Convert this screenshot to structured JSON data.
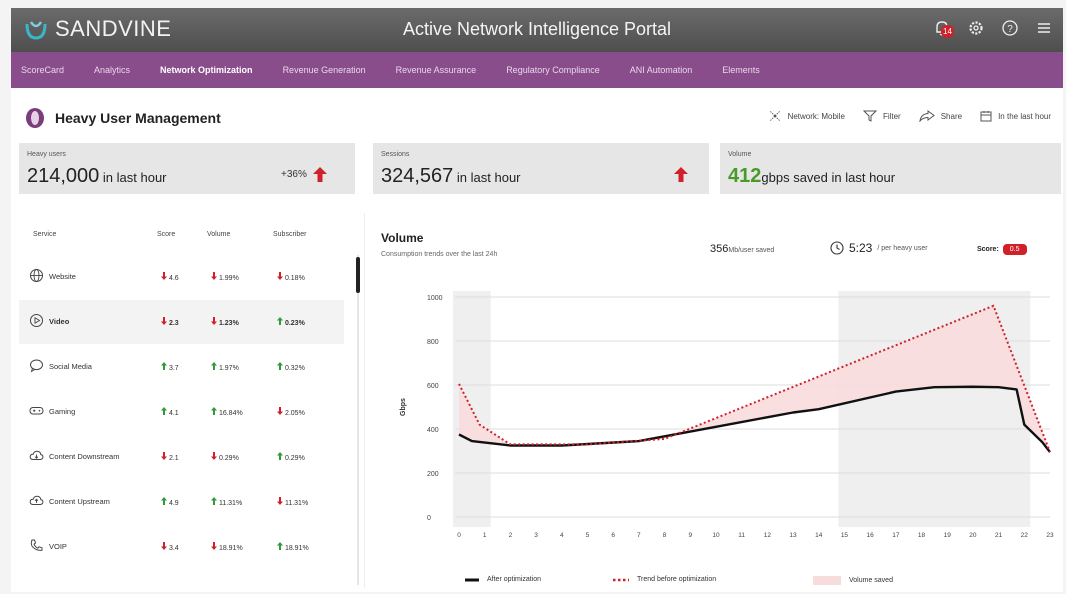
{
  "header": {
    "brand": "SANDVINE",
    "title": "Active Network Intelligence Portal",
    "notification_count": "14",
    "icons": [
      "notification-bell-icon",
      "settings-icon",
      "help-icon",
      "menu-icon"
    ]
  },
  "nav": {
    "items": [
      {
        "label": "ScoreCard",
        "active": false
      },
      {
        "label": "Analytics",
        "active": false
      },
      {
        "label": "Network Optimization",
        "active": true
      },
      {
        "label": "Revenue Generation",
        "active": false
      },
      {
        "label": "Revenue Assurance",
        "active": false
      },
      {
        "label": "Regulatory Compliance",
        "active": false
      },
      {
        "label": "ANI Automation",
        "active": false
      },
      {
        "label": "Elements",
        "active": false
      }
    ]
  },
  "page": {
    "title": "Heavy User Management",
    "actions": {
      "network": "Network: Mobile",
      "filter": "Filter",
      "share": "Share",
      "timeframe": "In the last hour"
    }
  },
  "kpis": {
    "heavy_users": {
      "label": "Heavy users",
      "value": "214,000",
      "suffix": " in last hour",
      "delta": "+36%"
    },
    "sessions": {
      "label": "Sessions",
      "value": "324,567",
      "suffix": " in last hour"
    },
    "volume": {
      "label": "Volume",
      "value": "412",
      "unit": "gbps",
      "suffix": " saved  in last hour"
    }
  },
  "services": {
    "headers": {
      "service": "Service",
      "score": "Score",
      "volume": "Volume",
      "subscriber": "Subscriber"
    },
    "rows": [
      {
        "name": "Website",
        "icon": "globe-icon",
        "score": "4.6",
        "score_dir": "down",
        "volume": "1.99%",
        "volume_dir": "down",
        "subscriber": "0.18%",
        "subscriber_dir": "down",
        "selected": false
      },
      {
        "name": "Video",
        "icon": "play-icon",
        "score": "2.3",
        "score_dir": "down",
        "volume": "1.23%",
        "volume_dir": "down",
        "subscriber": "0.23%",
        "subscriber_dir": "up",
        "selected": true
      },
      {
        "name": "Social Media",
        "icon": "chat-bubble-icon",
        "score": "3.7",
        "score_dir": "up",
        "volume": "1.97%",
        "volume_dir": "up",
        "subscriber": "0.32%",
        "subscriber_dir": "up",
        "selected": false
      },
      {
        "name": "Gaming",
        "icon": "gamepad-icon",
        "score": "4.1",
        "score_dir": "up",
        "volume": "16.84%",
        "volume_dir": "up",
        "subscriber": "2.05%",
        "subscriber_dir": "down",
        "selected": false
      },
      {
        "name": "Content Downstream",
        "icon": "cloud-download-icon",
        "score": "2.1",
        "score_dir": "down",
        "volume": "0.29%",
        "volume_dir": "down",
        "subscriber": "0.29%",
        "subscriber_dir": "up",
        "selected": false
      },
      {
        "name": "Content Upstream",
        "icon": "cloud-upload-icon",
        "score": "4.9",
        "score_dir": "up",
        "volume": "11.31%",
        "volume_dir": "up",
        "subscriber": "11.31%",
        "subscriber_dir": "down",
        "selected": false
      },
      {
        "name": "VOIP",
        "icon": "phone-icon",
        "score": "3.4",
        "score_dir": "down",
        "volume": "18.91%",
        "volume_dir": "down",
        "subscriber": "18.91%",
        "subscriber_dir": "up",
        "selected": false
      }
    ]
  },
  "volume_panel": {
    "title": "Volume",
    "subtitle": "Consumption trends over the last 24h",
    "saved_value": "356",
    "saved_unit": "Mb/user saved",
    "time_value": "5:23",
    "time_unit": " / per heavy user",
    "score_label": "Score:",
    "score_value": "0.5"
  },
  "chart_data": {
    "type": "line",
    "x": [
      0,
      1,
      2,
      3,
      4,
      5,
      6,
      7,
      8,
      9,
      10,
      11,
      12,
      13,
      14,
      15,
      16,
      17,
      18,
      19,
      20,
      21,
      22,
      23
    ],
    "ylabel": "Gbps",
    "ylim": [
      0,
      1000
    ],
    "yticks": [
      0,
      200,
      400,
      600,
      800,
      1000
    ],
    "highlight_ranges": [
      [
        0,
        1
      ],
      [
        15,
        22
      ]
    ],
    "series": [
      {
        "name": "After optimization",
        "style": "solid",
        "color": "#111111",
        "points": [
          [
            0,
            375
          ],
          [
            0.5,
            345
          ],
          [
            2,
            325
          ],
          [
            4,
            325
          ],
          [
            7,
            345
          ],
          [
            10,
            410
          ],
          [
            13,
            475
          ],
          [
            14,
            490
          ],
          [
            17,
            570
          ],
          [
            18.5,
            590
          ],
          [
            20,
            592
          ],
          [
            21,
            590
          ],
          [
            21.7,
            580
          ],
          [
            22,
            420
          ],
          [
            22.7,
            340
          ],
          [
            23,
            295
          ]
        ]
      },
      {
        "name": "Trend before optimization",
        "style": "dotted",
        "color": "#d0202a",
        "points": [
          [
            0,
            605
          ],
          [
            0.8,
            420
          ],
          [
            2,
            330
          ],
          [
            5,
            330
          ],
          [
            8,
            355
          ],
          [
            20.8,
            960
          ],
          [
            23,
            295
          ]
        ]
      }
    ],
    "fill": {
      "name": "Volume saved",
      "color": "#f8dcdc"
    },
    "grid": true,
    "legend": "bottom"
  }
}
